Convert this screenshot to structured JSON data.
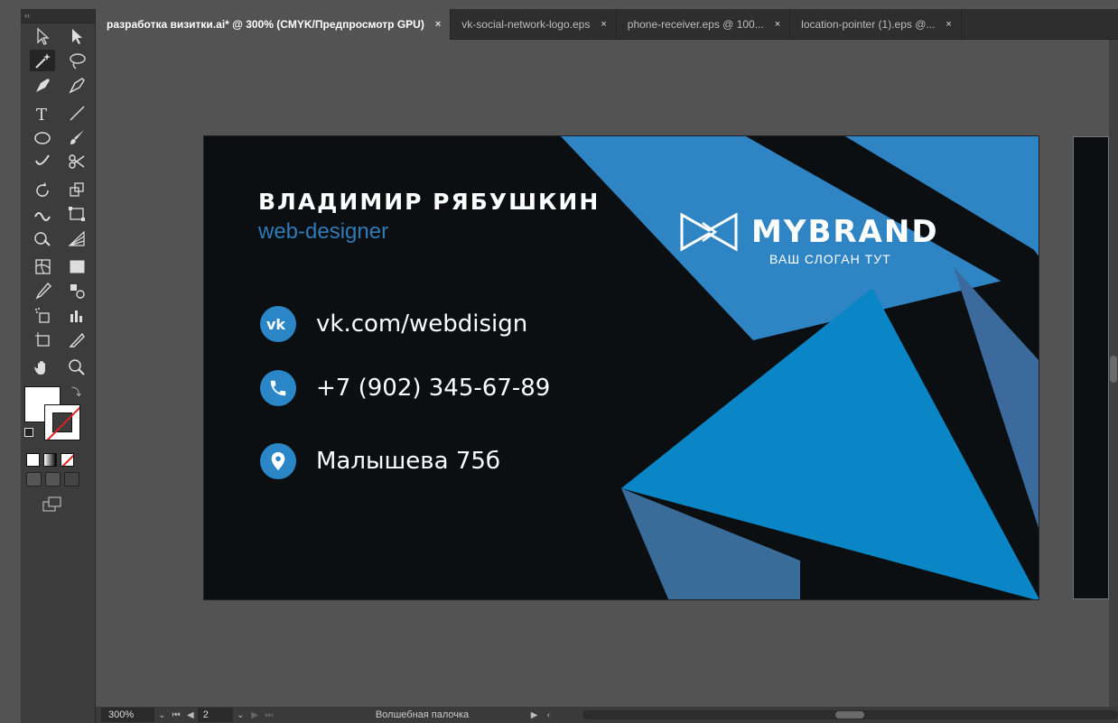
{
  "tabs": [
    {
      "label": "разработка визитки.ai* @ 300% (CMYK/Предпросмотр GPU)",
      "active": true
    },
    {
      "label": "vk-social-network-logo.eps",
      "active": false
    },
    {
      "label": "phone-receiver.eps @ 100...",
      "active": false
    },
    {
      "label": "location-pointer (1).eps @...",
      "active": false
    }
  ],
  "tab_close_glyph": "×",
  "toolbar": {
    "collapse_glyph": "‹‹",
    "tools": [
      [
        "selection-tool-icon",
        "direct-selection-tool-icon"
      ],
      [
        "magic-wand-tool-icon",
        "lasso-tool-icon"
      ],
      [
        "pen-tool-icon",
        "curvature-tool-icon"
      ],
      [
        "type-tool-icon",
        "line-segment-tool-icon"
      ],
      [
        "ellipse-tool-icon",
        "paintbrush-tool-icon"
      ],
      [
        "shaper-tool-icon",
        "scissors-tool-icon"
      ],
      [
        "rotate-tool-icon",
        "scale-tool-icon"
      ],
      [
        "width-tool-icon",
        "free-transform-tool-icon"
      ],
      [
        "shape-builder-tool-icon",
        "perspective-grid-tool-icon"
      ],
      [
        "mesh-tool-icon",
        "gradient-tool-icon"
      ],
      [
        "eyedropper-tool-icon",
        "blend-tool-icon"
      ],
      [
        "symbol-sprayer-tool-icon",
        "column-graph-tool-icon"
      ],
      [
        "artboard-tool-icon",
        "slice-tool-icon"
      ],
      [
        "hand-tool-icon",
        "zoom-tool-icon"
      ]
    ]
  },
  "card": {
    "name": "ВЛАДИМИР РЯБУШКИН",
    "role": "web-designer",
    "contacts": [
      {
        "icon": "vk-icon",
        "text": "vk.com/webdisign"
      },
      {
        "icon": "phone-icon",
        "text": "+7 (902) 345-67-89"
      },
      {
        "icon": "location-pin-icon",
        "text": "Малышева 75б"
      }
    ],
    "brand": "MYBRAND",
    "slogan": "ВАШ СЛОГАН ТУТ",
    "colors": {
      "background": "#0b0f12",
      "accent_light": "#2a86c7",
      "accent_mid": "#1f6fa8",
      "accent_dark": "#3a6c9a"
    }
  },
  "status": {
    "zoom": "300%",
    "page": "2",
    "tool": "Волшебная палочка"
  }
}
